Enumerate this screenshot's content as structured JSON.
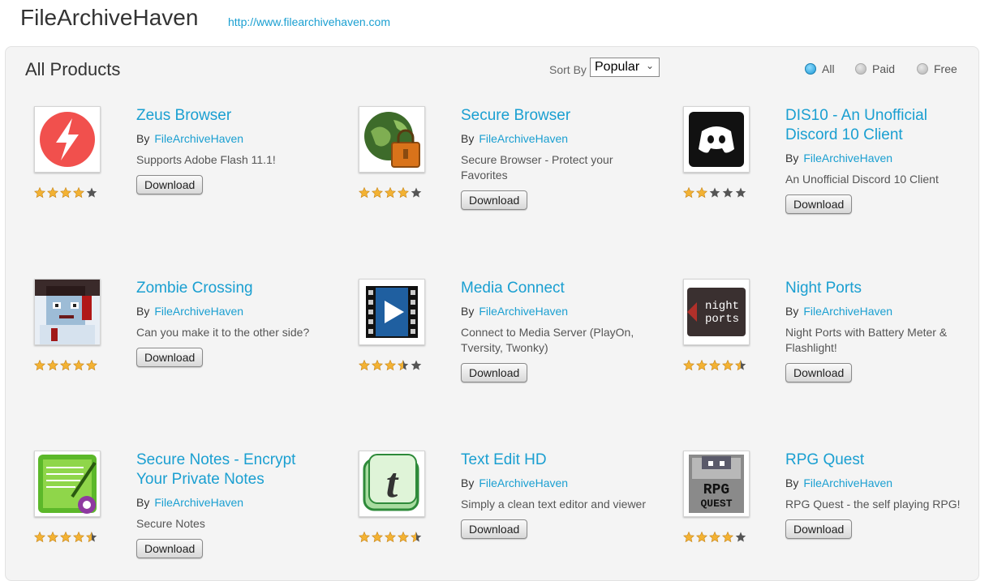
{
  "site": {
    "title": "FileArchiveHaven",
    "url": "http://www.filearchivehaven.com"
  },
  "panel": {
    "title": "All Products"
  },
  "sort": {
    "label": "Sort By",
    "value": "Popular"
  },
  "filters": [
    {
      "label": "All",
      "selected": true
    },
    {
      "label": "Paid",
      "selected": false
    },
    {
      "label": "Free",
      "selected": false
    }
  ],
  "colors": {
    "accent": "#1a9fd1",
    "star": "#f3b233",
    "star_empty": "#555555"
  },
  "products": [
    {
      "title": "Zeus Browser",
      "by": "By",
      "author": "FileArchiveHaven",
      "desc": "Supports Adobe Flash 11.1!",
      "button": "Download",
      "rating": 4,
      "icon": "lightning-icon"
    },
    {
      "title": "Secure Browser",
      "by": "By",
      "author": "FileArchiveHaven",
      "desc": "Secure Browser - Protect your Favorites",
      "button": "Download",
      "rating": 4,
      "icon": "globe-lock-icon"
    },
    {
      "title": "DIS10 - An Unofficial Discord 10 Client",
      "by": "By",
      "author": "FileArchiveHaven",
      "desc": "An Unofficial Discord 10 Client",
      "button": "Download",
      "rating": 2,
      "icon": "discord-icon"
    },
    {
      "title": "Zombie Crossing",
      "by": "By",
      "author": "FileArchiveHaven",
      "desc": "Can you make it to the other side?",
      "button": "Download",
      "rating": 5,
      "icon": "zombie-icon"
    },
    {
      "title": "Media Connect",
      "by": "By",
      "author": "FileArchiveHaven",
      "desc": "Connect to Media Server (PlayOn, Tversity, Twonky)",
      "button": "Download",
      "rating": 3.5,
      "icon": "film-play-icon"
    },
    {
      "title": "Night Ports",
      "by": "By",
      "author": "FileArchiveHaven",
      "desc": "Night Ports with Battery Meter & Flashlight!",
      "button": "Download",
      "rating": 4.5,
      "icon": "night-ports-icon",
      "icon_text": [
        "night",
        "ports"
      ]
    },
    {
      "title": "Secure Notes - Encrypt Your Private Notes",
      "by": "By",
      "author": "FileArchiveHaven",
      "desc": "Secure Notes",
      "button": "Download",
      "rating": 4.5,
      "icon": "notepad-lock-icon"
    },
    {
      "title": "Text Edit HD",
      "by": "By",
      "author": "FileArchiveHaven",
      "desc": "Simply a clean text editor and viewer",
      "button": "Download",
      "rating": 4.5,
      "icon": "text-edit-icon",
      "icon_text": [
        "t"
      ]
    },
    {
      "title": "RPG Quest",
      "by": "By",
      "author": "FileArchiveHaven",
      "desc": "RPG Quest - the self playing RPG!",
      "button": "Download",
      "rating": 4,
      "icon": "rpg-quest-icon",
      "icon_text": [
        "RPG",
        "QUEST"
      ]
    }
  ]
}
